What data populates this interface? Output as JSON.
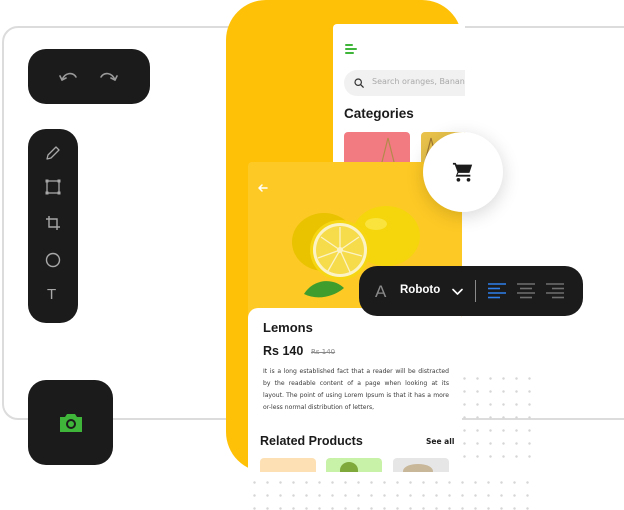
{
  "colors": {
    "accent_yellow": "#ffc107",
    "green_accent": "#3fb53a",
    "dark_panel": "#1b1b1b",
    "blue_active": "#2f80ed"
  },
  "history_toolbar": {
    "undo_icon": "undo-icon",
    "redo_icon": "redo-icon"
  },
  "tools_toolbar": {
    "tools": [
      "pencil-icon",
      "rectangle-icon",
      "crop-icon",
      "circle-icon",
      "text-tool-icon"
    ],
    "text_tool_glyph": "T"
  },
  "camera_button": {
    "icon": "camera-icon"
  },
  "back_screen": {
    "menu_icon": "hamburger-menu-icon",
    "search_placeholder": "Search oranges, Banan",
    "categories_title": "Categories"
  },
  "product": {
    "name": "Lemons",
    "price": "Rs 140",
    "old_price": "Rs 140",
    "description": "It is a long established fact that a reader will be distracted by the readable content of a page when looking at its layout. The point of using Lorem Ipsum is that it has a more or-less normal distribution of letters,",
    "related_title": "Related Products",
    "see_all": "See all"
  },
  "cart": {
    "icon": "shopping-cart-icon"
  },
  "font_toolbar": {
    "font_glyph": "A",
    "font_name": "Roboto",
    "alignments": [
      "align-left-icon",
      "align-center-icon",
      "align-right-icon"
    ],
    "active_alignment": "align-left-icon"
  }
}
